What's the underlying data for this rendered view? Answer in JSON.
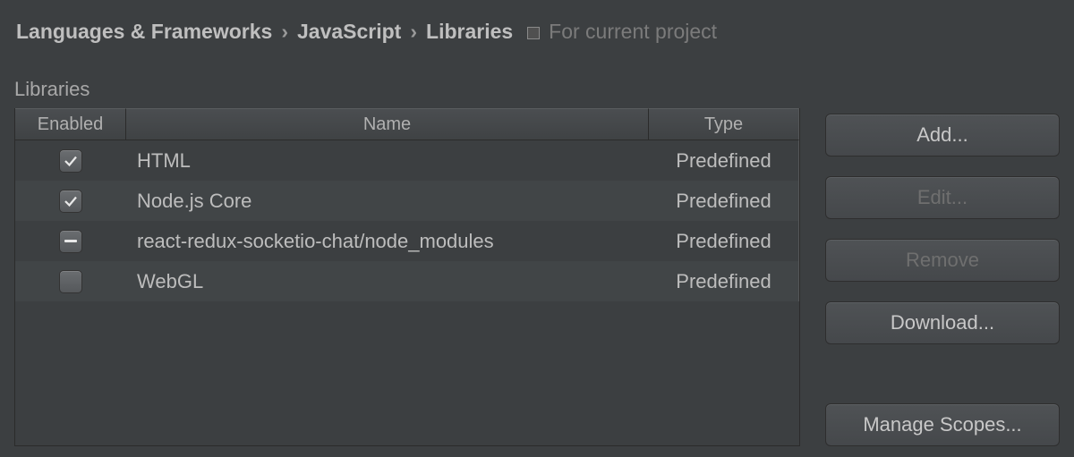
{
  "breadcrumb": {
    "items": [
      "Languages & Frameworks",
      "JavaScript",
      "Libraries"
    ],
    "sep": "›",
    "for_project": "For current project"
  },
  "section_label": "Libraries",
  "table": {
    "headers": {
      "enabled": "Enabled",
      "name": "Name",
      "type": "Type"
    },
    "rows": [
      {
        "state": "checked",
        "name": "HTML",
        "type": "Predefined"
      },
      {
        "state": "checked",
        "name": "Node.js Core",
        "type": "Predefined"
      },
      {
        "state": "indeterminate",
        "name": "react-redux-socketio-chat/node_modules",
        "type": "Predefined"
      },
      {
        "state": "unchecked",
        "name": "WebGL",
        "type": "Predefined"
      }
    ]
  },
  "buttons": {
    "add": "Add...",
    "edit": "Edit...",
    "remove": "Remove",
    "download": "Download...",
    "manage_scopes": "Manage Scopes..."
  }
}
